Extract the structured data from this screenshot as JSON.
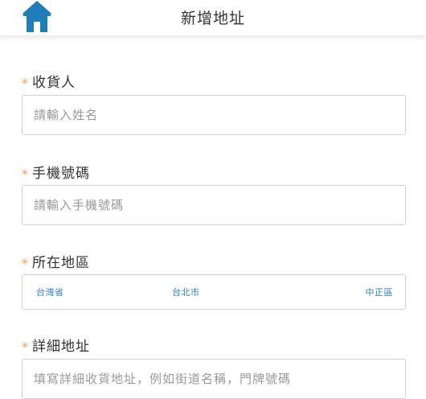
{
  "header": {
    "title": "新增地址",
    "home_icon": "home-icon",
    "home_color": "#1e7fb8"
  },
  "form": {
    "required_mark": "*",
    "recipient": {
      "label": "收貨人",
      "placeholder": "請輸入姓名"
    },
    "phone": {
      "label": "手機號碼",
      "placeholder": "請輸入手機號碼"
    },
    "region": {
      "label": "所在地區",
      "county": "台灣省",
      "city": "台北市",
      "district": "中正區"
    },
    "address": {
      "label": "詳細地址",
      "placeholder": "填寫詳細收貨地址，例如街道名稱，門牌號碼"
    }
  },
  "colors": {
    "accent": "#2d7fc8",
    "required": "#f0a04a",
    "border": "#d2d2d2"
  }
}
